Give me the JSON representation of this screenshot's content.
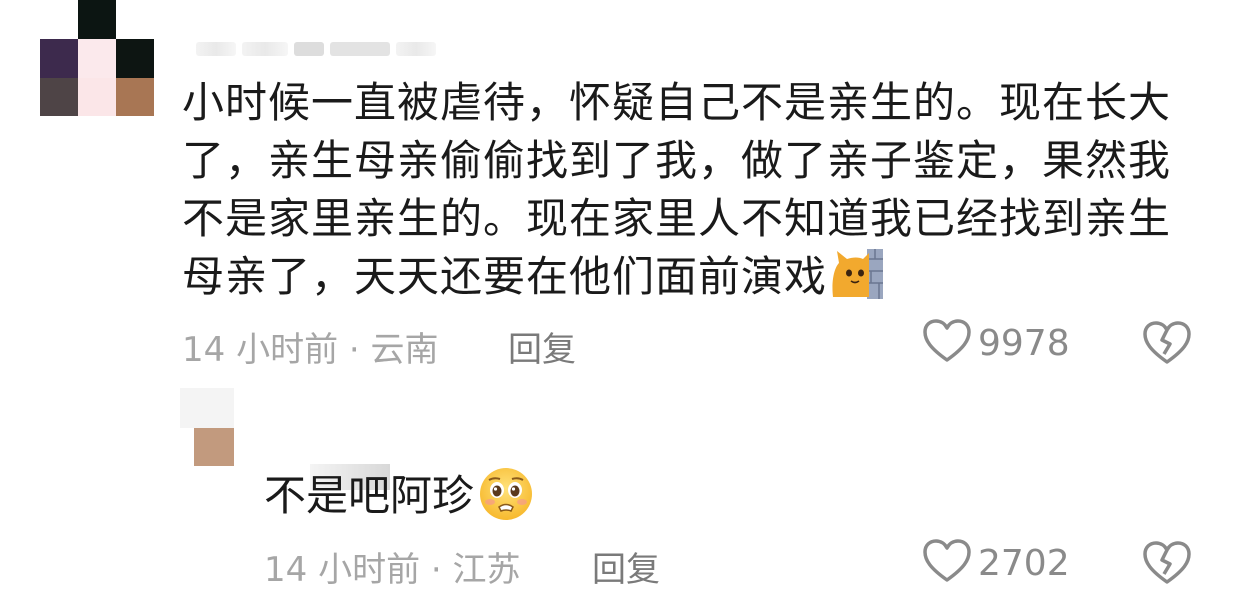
{
  "comments": [
    {
      "text": "小时候一直被虐待，怀疑自己不是亲生的。现在长大了，亲生母亲偷偷找到了我，做了亲子鉴定，果然我不是家里亲生的。现在家里人不知道我已经找到亲生母亲了，天天还要在他们面前演戏",
      "emoji": "cat-peeking-emoji",
      "time": "14 小时前",
      "separator": "·",
      "location": "云南",
      "reply_label": "回复",
      "likes": "9978"
    },
    {
      "text": "不是吧阿珍",
      "emoji": "pleading-face-emoji",
      "time": "14 小时前",
      "separator": "·",
      "location": "江苏",
      "reply_label": "回复",
      "likes": "2702"
    }
  ],
  "colors": {
    "text": "#1a1a1a",
    "meta": "#a6a6a6",
    "reply": "#7a7a7a",
    "icon": "#8a8a8a"
  }
}
